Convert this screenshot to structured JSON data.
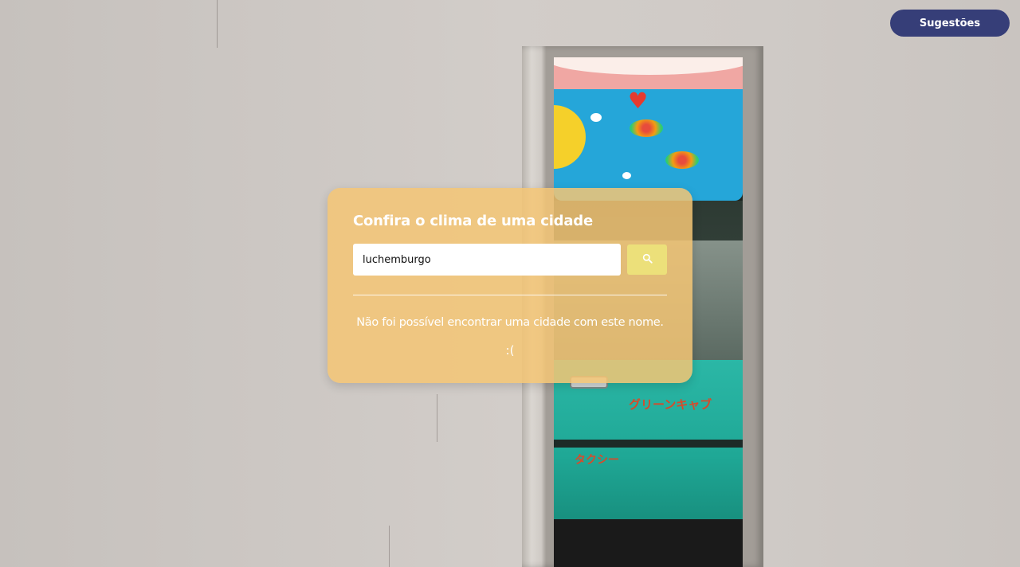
{
  "header": {
    "suggestions_label": "Sugestões"
  },
  "card": {
    "title": "Confira o clima de uma cidade",
    "search": {
      "value": "luchemburgo",
      "placeholder": "",
      "button_icon": "search-icon"
    },
    "error_message": "Não foi possível encontrar uma cidade com este nome.",
    "error_face": ":("
  },
  "background": {
    "japanese_text_1": "グリーンキャブ",
    "japanese_text_2": "タクシー"
  },
  "colors": {
    "card_bg": "#f5c674",
    "suggestions_button": "#363e78",
    "search_button": "#ece07a",
    "text": "#ffffff"
  }
}
